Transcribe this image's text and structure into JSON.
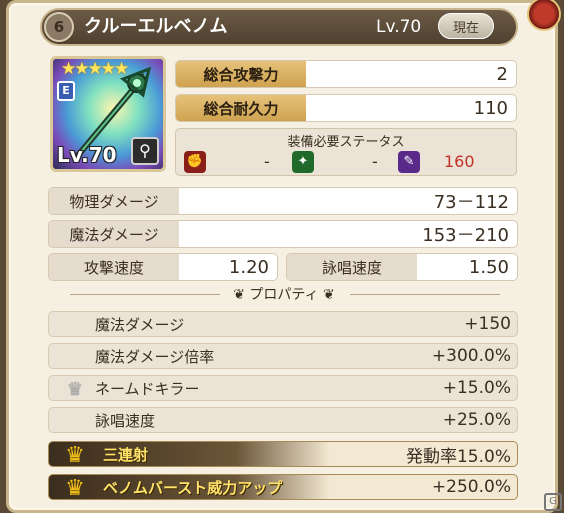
{
  "header": {
    "item_name": "クルーエルベノム",
    "level": "Lv.70",
    "current_button": "現在"
  },
  "portrait": {
    "rarity_letter": "E",
    "stars": "★★★★★",
    "level": "Lv.70"
  },
  "totals": {
    "attack_label": "総合攻撃力",
    "attack_value": "2",
    "durability_label": "総合耐久力",
    "durability_value": "110"
  },
  "requirements": {
    "title": "装備必要ステータス",
    "items": [
      {
        "icon": "strength-icon",
        "value": "-",
        "color": "#c0302a"
      },
      {
        "icon": "dexterity-icon",
        "value": "-",
        "color": "#2f8a3a"
      },
      {
        "icon": "magic-icon",
        "value": "160",
        "color": "#7a3ab8",
        "value_color": "#c0302a"
      }
    ]
  },
  "stats": {
    "physical_damage_label": "物理ダメージ",
    "physical_damage_value": "73－112",
    "magic_damage_label": "魔法ダメージ",
    "magic_damage_value": "153－210",
    "attack_speed_label": "攻撃速度",
    "attack_speed_value": "1.20",
    "cast_speed_label": "詠唱速度",
    "cast_speed_value": "1.50"
  },
  "properties": {
    "header": "プロパティ",
    "items": [
      {
        "name": "魔法ダメージ",
        "value": "+150",
        "icon": ""
      },
      {
        "name": "魔法ダメージ倍率",
        "value": "+300.0%",
        "icon": ""
      },
      {
        "name": "ネームドキラー",
        "value": "+15.0%",
        "icon": "silver-crown-icon"
      },
      {
        "name": "詠唱速度",
        "value": "+25.0%",
        "icon": ""
      },
      {
        "name": "三連射",
        "value": "発動率15.0%",
        "icon": "gold-crown-icon"
      },
      {
        "name": "ベノムバースト威力アップ",
        "value": "+250.0%",
        "icon": "gold-crown-icon"
      }
    ]
  }
}
